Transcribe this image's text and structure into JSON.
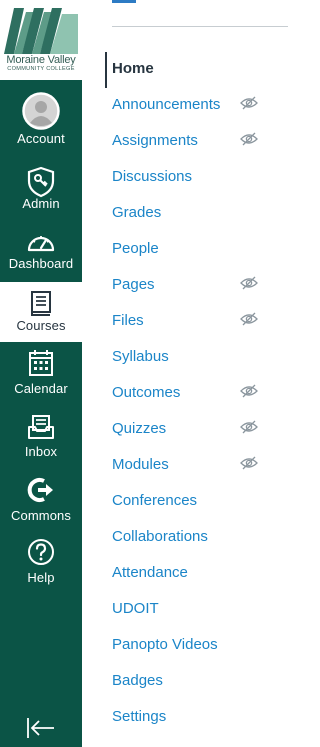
{
  "logo": {
    "line1": "Moraine Valley",
    "line2": "COMMUNITY COLLEGE",
    "colors": {
      "mark_dark": "#2e6f60",
      "mark_light": "#8fc3b0"
    }
  },
  "global_nav": {
    "background": "#0b5446",
    "items": [
      {
        "label": "Account",
        "icon": "avatar-icon"
      },
      {
        "label": "Admin",
        "icon": "shield-key-icon"
      },
      {
        "label": "Dashboard",
        "icon": "gauge-icon"
      },
      {
        "label": "Courses",
        "icon": "book-icon",
        "active": true
      },
      {
        "label": "Calendar",
        "icon": "calendar-icon"
      },
      {
        "label": "Inbox",
        "icon": "inbox-icon"
      },
      {
        "label": "Commons",
        "icon": "commons-arrow-icon"
      },
      {
        "label": "Help",
        "icon": "help-circle-icon"
      }
    ],
    "collapse_icon": "collapse-nav-icon"
  },
  "course_nav": {
    "link_color": "#1b85c8",
    "active_color": "#273540",
    "items": [
      {
        "label": "Home",
        "active": true
      },
      {
        "label": "Announcements",
        "hidden_from_students": true
      },
      {
        "label": "Assignments",
        "hidden_from_students": true
      },
      {
        "label": "Discussions"
      },
      {
        "label": "Grades"
      },
      {
        "label": "People"
      },
      {
        "label": "Pages",
        "hidden_from_students": true
      },
      {
        "label": "Files",
        "hidden_from_students": true
      },
      {
        "label": "Syllabus"
      },
      {
        "label": "Outcomes",
        "hidden_from_students": true
      },
      {
        "label": "Quizzes",
        "hidden_from_students": true
      },
      {
        "label": "Modules",
        "hidden_from_students": true
      },
      {
        "label": "Conferences"
      },
      {
        "label": "Collaborations"
      },
      {
        "label": "Attendance"
      },
      {
        "label": "UDOIT"
      },
      {
        "label": "Panopto Videos"
      },
      {
        "label": "Badges"
      },
      {
        "label": "Settings"
      }
    ]
  }
}
